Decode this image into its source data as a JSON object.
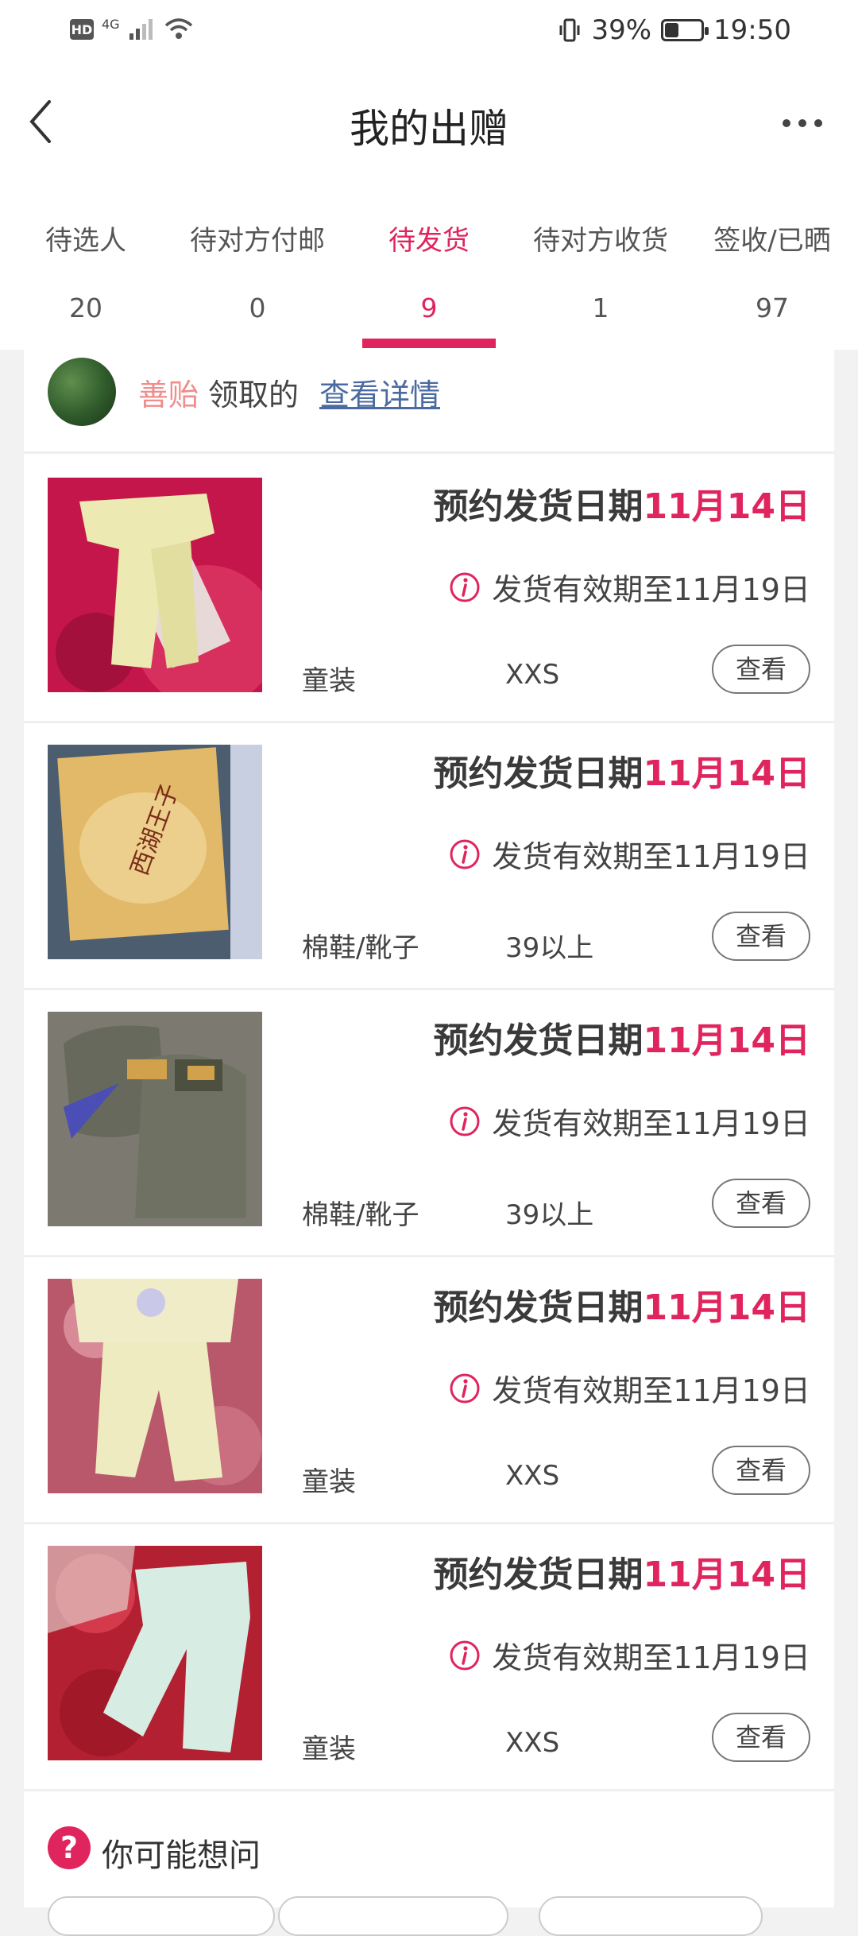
{
  "status_bar": {
    "hd": "HD",
    "network": "4G",
    "battery_text": "39%",
    "battery_level": 0.39,
    "time": "19:50"
  },
  "header": {
    "title": "我的出赠"
  },
  "tabs": [
    {
      "label": "待选人",
      "count": "20",
      "active": false
    },
    {
      "label": "待对方付邮",
      "count": "0",
      "active": false
    },
    {
      "label": "待发货",
      "count": "9",
      "active": true
    },
    {
      "label": "待对方收货",
      "count": "1",
      "active": false
    },
    {
      "label": "签收/已晒",
      "count": "97",
      "active": false
    }
  ],
  "donor": {
    "name": "善贻",
    "text": "领取的",
    "link": "查看详情"
  },
  "items": [
    {
      "date_prefix": "预约发货日期",
      "date": "11月14日",
      "validity": "发货有效期至11月19日",
      "category": "童装",
      "size": "XXS",
      "button": "查看",
      "thumb": "baby-pants-yellow"
    },
    {
      "date_prefix": "预约发货日期",
      "date": "11月14日",
      "validity": "发货有效期至11月19日",
      "category": "棉鞋/靴子",
      "size": "39以上",
      "button": "查看",
      "thumb": "shoe-box"
    },
    {
      "date_prefix": "预约发货日期",
      "date": "11月14日",
      "validity": "发货有效期至11月19日",
      "category": "棉鞋/靴子",
      "size": "39以上",
      "button": "查看",
      "thumb": "grey-shoes"
    },
    {
      "date_prefix": "预约发货日期",
      "date": "11月14日",
      "validity": "发货有效期至11月19日",
      "category": "童装",
      "size": "XXS",
      "button": "查看",
      "thumb": "baby-outfit"
    },
    {
      "date_prefix": "预约发货日期",
      "date": "11月14日",
      "validity": "发货有效期至11月19日",
      "category": "童装",
      "size": "XXS",
      "button": "查看",
      "thumb": "baby-pants-mint"
    }
  ],
  "faq": {
    "title": "你可能想问"
  },
  "colors": {
    "accent": "#e0245e",
    "donor_name": "#f08c8c",
    "link": "#4a6aa0"
  }
}
